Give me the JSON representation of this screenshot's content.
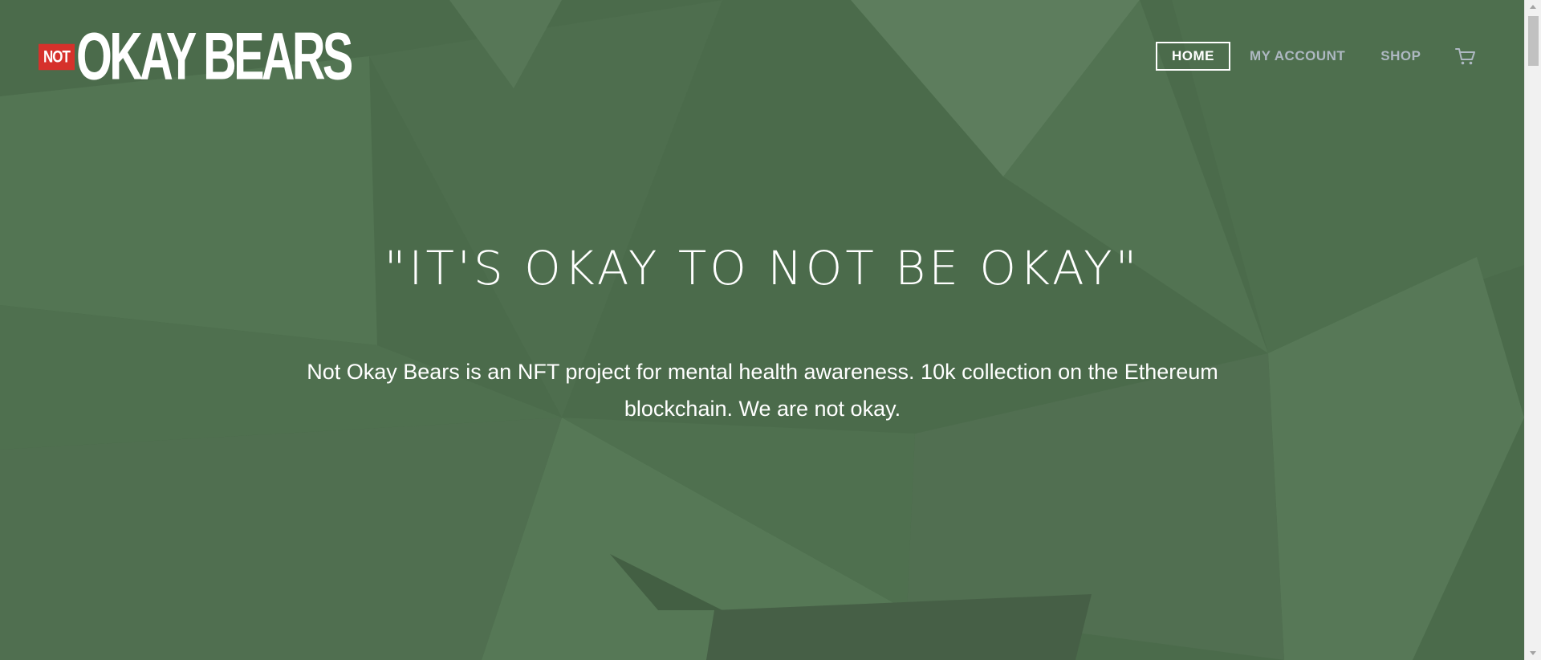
{
  "brand": {
    "logo_not": "NOT",
    "logo_main": "OKAY BEARS"
  },
  "nav": {
    "items": [
      {
        "label": "HOME",
        "active": true
      },
      {
        "label": "MY ACCOUNT",
        "active": false
      },
      {
        "label": "SHOP",
        "active": false
      }
    ],
    "cart_icon": "cart-icon"
  },
  "hero": {
    "title": "\"IT'S OKAY TO NOT BE OKAY\"",
    "description": "Not Okay Bears is an NFT project for mental health awareness. 10k collection on the Ethereum blockchain. We are not okay."
  },
  "colors": {
    "background": "#4b6b4b",
    "logo_accent": "#d6312b",
    "nav_inactive": "#aeb8c2",
    "text": "#ffffff"
  }
}
